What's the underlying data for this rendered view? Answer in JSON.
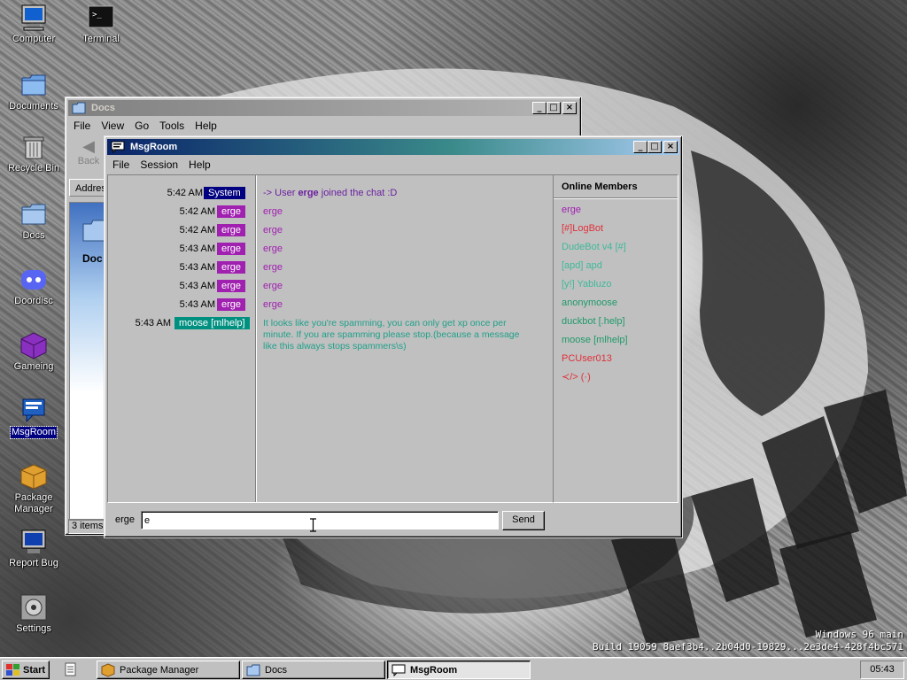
{
  "desktop": {
    "icons": [
      {
        "label": "Computer",
        "icon": "computer-icon"
      },
      {
        "label": "Terminal",
        "icon": "terminal-icon"
      },
      {
        "label": "Documents",
        "icon": "documents-icon"
      },
      {
        "label": "Recycle Bin",
        "icon": "recycle-bin-icon"
      },
      {
        "label": "Docs",
        "icon": "folder-icon"
      },
      {
        "label": "Doordisc",
        "icon": "doordisc-icon"
      },
      {
        "label": "Gameing",
        "icon": "game-cube-icon"
      },
      {
        "label": "MsgRoom",
        "icon": "msgroom-icon"
      },
      {
        "label": "Package Manager",
        "icon": "package-icon"
      },
      {
        "label": "Report Bug",
        "icon": "report-bug-icon"
      },
      {
        "label": "Settings",
        "icon": "settings-icon"
      }
    ],
    "sysinfo_line1": "Windows 96 main",
    "sysinfo_line2": "Build 19059 8aef3b4..2b04d0-19829...2e3de4-428f4bc571"
  },
  "docs_window": {
    "title": "Docs",
    "menu": [
      "File",
      "View",
      "Go",
      "Tools",
      "Help"
    ],
    "back_label": "Back",
    "address_label": "Addres",
    "folder_label": "Doc",
    "status": "3 items"
  },
  "msgroom": {
    "title": "MsgRoom",
    "menu": [
      "File",
      "Session",
      "Help"
    ],
    "messages": [
      {
        "time": "5:42 AM",
        "nick": "System",
        "text_prefix": "-> User ",
        "text_user": "erge",
        "text_suffix": " joined the chat :D"
      },
      {
        "time": "5:42 AM",
        "nick": "erge",
        "text": "erge"
      },
      {
        "time": "5:42 AM",
        "nick": "erge",
        "text": "erge"
      },
      {
        "time": "5:43 AM",
        "nick": "erge",
        "text": "erge"
      },
      {
        "time": "5:43 AM",
        "nick": "erge",
        "text": "erge"
      },
      {
        "time": "5:43 AM",
        "nick": "erge",
        "text": "erge"
      },
      {
        "time": "5:43 AM",
        "nick": "erge",
        "text": "erge"
      },
      {
        "time": "5:43 AM",
        "nick": "moose [mlhelp]",
        "text_l1": "It looks like you're spamming, you can only get xp once per",
        "text_l2": "minute. If you are spamming please stop.(because a message",
        "text_l3": "like this always stops spammers\\s)"
      }
    ],
    "members_title": "Online Members",
    "members": [
      {
        "name": "erge",
        "color": "#a020b0"
      },
      {
        "name": "[#]LogBot",
        "color": "#e0303a"
      },
      {
        "name": "DudeBot v4 [#]",
        "color": "#3fb89a"
      },
      {
        "name": "[apd] apd",
        "color": "#3fb89a"
      },
      {
        "name": "[y!] Yabluzo",
        "color": "#3fb89a"
      },
      {
        "name": "anonymoose",
        "color": "#1e9a6a"
      },
      {
        "name": "duckbot [.help]",
        "color": "#1e9a6a"
      },
      {
        "name": "moose [mlhelp]",
        "color": "#1e9a6a"
      },
      {
        "name": "PCUser013",
        "color": "#e0303a"
      },
      {
        "name": "≺/> (·)",
        "color": "#e0303a"
      }
    ],
    "input_nick": "erge",
    "input_value": "e",
    "send_label": "Send",
    "colors": {
      "system_bg": "#000080",
      "erge_bg": "#a020b0",
      "moose_bg": "#009080",
      "system_text": "#6b1fa0",
      "erge_text": "#a020b0",
      "moose_text": "#20a08a"
    }
  },
  "taskbar": {
    "start_label": "Start",
    "tasks": [
      {
        "label": "Package Manager",
        "icon": "package-icon"
      },
      {
        "label": "Docs",
        "icon": "folder-icon"
      },
      {
        "label": "MsgRoom",
        "icon": "msgroom-icon"
      }
    ],
    "clock": "05:43"
  }
}
